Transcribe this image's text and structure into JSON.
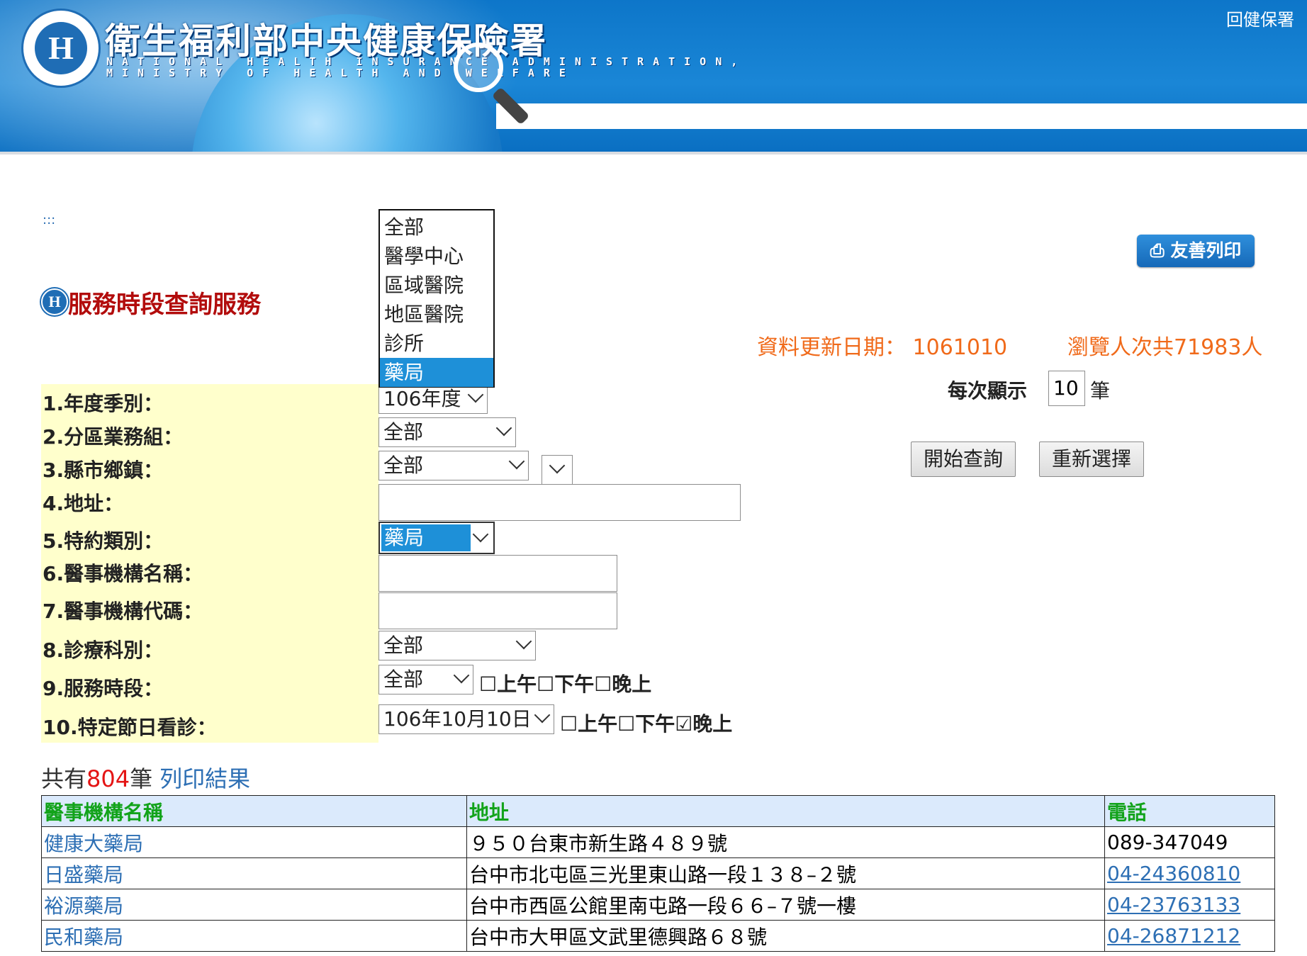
{
  "header": {
    "agency_name": "衛生福利部中央健康保險署",
    "agency_en_line1": "NATIONAL HEALTH INSURANCE ADMINISTRATION,",
    "agency_en_line2": "MINISTRY OF HEALTH AND WELFARE",
    "logo_letter": "H",
    "back_link": "回健保署"
  },
  "breadcrumb": ":::",
  "page_title": "服務時段查詢服務",
  "title_icon": "H",
  "print_button": "友善列印",
  "update_info": "資料更新日期： 1061010",
  "visits_info": "瀏覽人次共71983人",
  "per_page": {
    "label": "每次顯示",
    "value": "10",
    "unit": "筆"
  },
  "buttons": {
    "query": "開始查詢",
    "reset": "重新選擇"
  },
  "form": {
    "year_label": "1.年度季別：",
    "year_value": "106年度",
    "region_label": "2.分區業務組：",
    "region_value": "全部",
    "county_label": "3.縣市鄉鎮：",
    "county_value": "全部",
    "town_value": "",
    "address_label": "4.地址：",
    "type_label": "5.特約類別：",
    "type_value": "藥局",
    "type_options": [
      "全部",
      "醫學中心",
      "區域醫院",
      "地區醫院",
      "診所",
      "藥局"
    ],
    "name_label": "6.醫事機構名稱：",
    "code_label": "7.醫事機構代碼：",
    "dept_label": "8.診療科別：",
    "dept_value": "全部",
    "period_label": "9.服務時段：",
    "period_value": "全部",
    "period_checks": "☐上午☐下午☐晚上",
    "holiday_label": "10.特定節日看診：",
    "holiday_value": "106年10月10日",
    "holiday_checks": "☐上午☐下午☑晚上"
  },
  "results": {
    "prefix": "共有",
    "count": "804",
    "suffix": "筆",
    "print_link": "列印結果",
    "columns": [
      "醫事機構名稱",
      "地址",
      "電話"
    ],
    "rows": [
      {
        "name": "健康大藥局",
        "address": "９５０台東市新生路４８９號",
        "phone": "089-347049"
      },
      {
        "name": "日盛藥局",
        "address": "台中市北屯區三光里東山路一段１３８–２號",
        "phone": "04-24360810"
      },
      {
        "name": "裕源藥局",
        "address": "台中市西區公館里南屯路一段６６–７號一樓",
        "phone": "04-23763133"
      },
      {
        "name": "民和藥局",
        "address": "台中市大甲區文武里德興路６８號",
        "phone": "04-26871212"
      }
    ]
  }
}
